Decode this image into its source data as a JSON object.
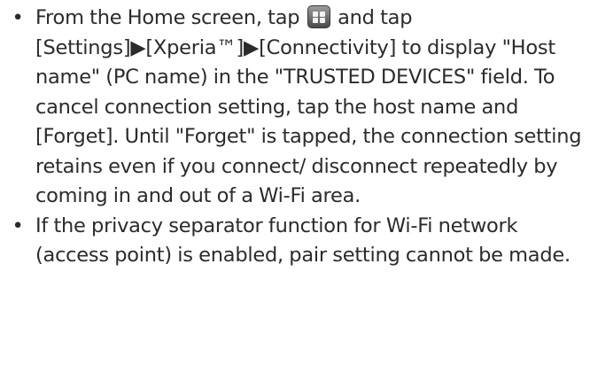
{
  "bullets": [
    {
      "dot": "•",
      "before_icon": "From the Home screen, tap ",
      "icon": "app-grid-icon",
      "after_icon": " and tap [Settings]▶[Xperia™]▶[Connectivity] to display \"Host name\" (PC name) in the \"TRUSTED DEVICES\" field. To cancel connection setting, tap the host name and [Forget]. Until \"Forget\" is tapped, the connection setting retains even if you connect/ disconnect repeatedly by coming in and out of a Wi-Fi area."
    },
    {
      "dot": "•",
      "text": "If the privacy separator function for Wi-Fi network (access point) is enabled, pair setting cannot be made."
    }
  ]
}
